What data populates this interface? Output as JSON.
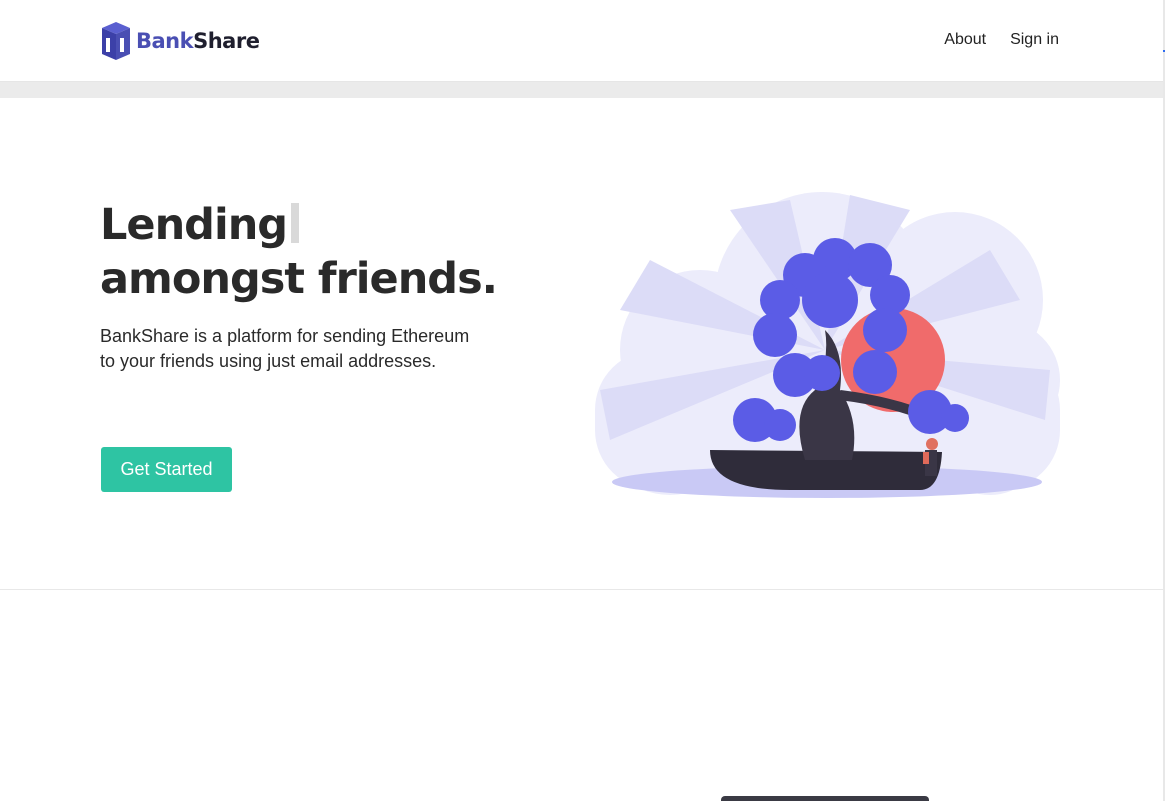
{
  "brand": {
    "name_part1": "Bank",
    "name_part2": "Share",
    "accent_color": "#4a4fb3"
  },
  "nav": {
    "links": [
      {
        "label": "About"
      },
      {
        "label": "Sign in"
      }
    ]
  },
  "hero": {
    "headline_line1": "Lending",
    "headline_line2": "amongst friends.",
    "description": "BankShare is a platform for sending Ethereum to your friends using just email addresses.",
    "cta_label": "Get Started",
    "cta_color": "#2ec4a3"
  },
  "illustration": {
    "icon": "bonsai-tree-illustration"
  }
}
